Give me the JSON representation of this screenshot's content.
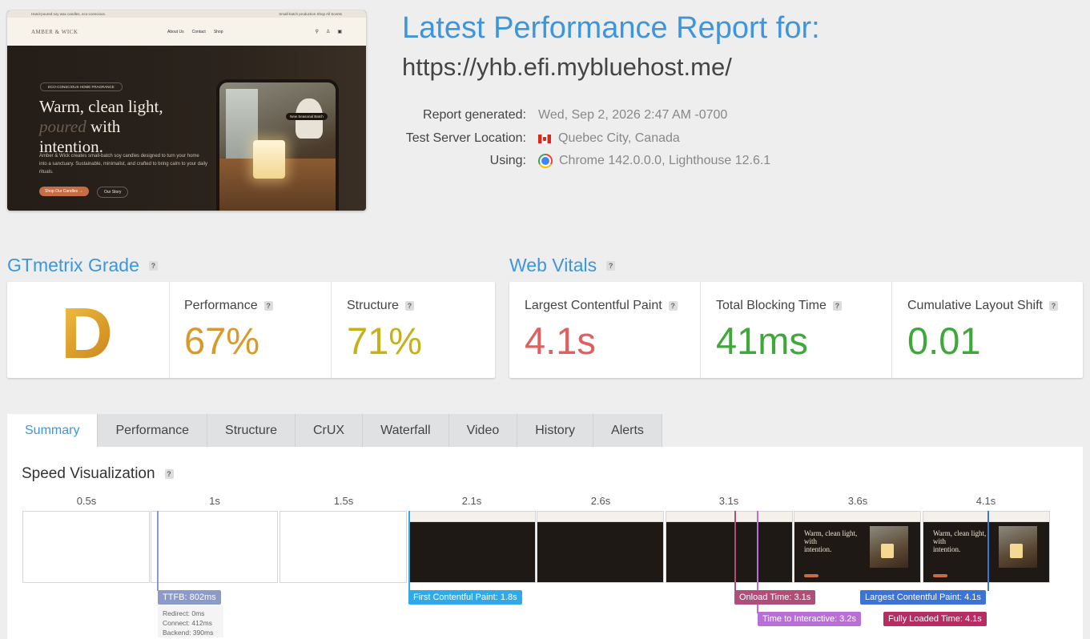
{
  "screenshot": {
    "topbar_left": "Hand-poured soy wax candles, eco-conscious.",
    "topbar_right": "Small-batch production   Shop All Scents",
    "logo": "AMBER & WICK",
    "nav": [
      "About Us",
      "Contact",
      "Shop"
    ],
    "pill": "ECO-CONSCIOUS HOME FRAGRANCE",
    "headline_1": "Warm, clean light,",
    "headline_2_italic": "poured",
    "headline_2": " with",
    "headline_3": "intention.",
    "lede": "Amber & Wick creates small-batch soy candles designed to turn your home into a sanctuary. Sustainable, minimalist, and crafted to bring calm to your daily rituals.",
    "cta_primary": "Shop Our Candles →",
    "cta_secondary": "Our Story",
    "badge": "New Seasonal Batch"
  },
  "header": {
    "title": "Latest Performance Report for:",
    "url": "https://yhb.efi.mybluehost.me/",
    "report_generated_label": "Report generated:",
    "report_generated_value": "Wed, Sep 2, 2026 2:47 AM -0700",
    "location_label": "Test Server Location:",
    "location_value": "Quebec City, Canada",
    "using_label": "Using:",
    "using_value": "Chrome 142.0.0.0, Lighthouse 12.6.1"
  },
  "grade": {
    "heading": "GTmetrix Grade",
    "letter": "D",
    "performance_label": "Performance",
    "performance_value": "67%",
    "structure_label": "Structure",
    "structure_value": "71%"
  },
  "vitals": {
    "heading": "Web Vitals",
    "lcp_label": "Largest Contentful Paint",
    "lcp_value": "4.1s",
    "tbt_label": "Total Blocking Time",
    "tbt_value": "41ms",
    "cls_label": "Cumulative Layout Shift",
    "cls_value": "0.01"
  },
  "colors": {
    "accent": "#3d96dd",
    "grade_d": "#d99c29",
    "performance": "#d99a2b",
    "structure": "#c7b11a",
    "lcp": "#e05f5f",
    "good": "#3fa83a"
  },
  "tabs": [
    "Summary",
    "Performance",
    "Structure",
    "CrUX",
    "Waterfall",
    "Video",
    "History",
    "Alerts"
  ],
  "speed": {
    "heading": "Speed Visualization",
    "times": [
      "0.5s",
      "1s",
      "1.5s",
      "2.1s",
      "2.6s",
      "3.1s",
      "3.6s",
      "4.1s"
    ],
    "ttfb": "TTFB: 802ms",
    "redirect": "Redirect: 0ms",
    "connect": "Connect: 412ms",
    "backend": "Backend: 390ms",
    "fcp": "First Contentful Paint: 1.8s",
    "onload": "Onload Time: 3.1s",
    "tti": "Time to Interactive: 3.2s",
    "lcp": "Largest Contentful Paint: 4.1s",
    "fully_loaded": "Fully Loaded Time: 4.1s"
  }
}
